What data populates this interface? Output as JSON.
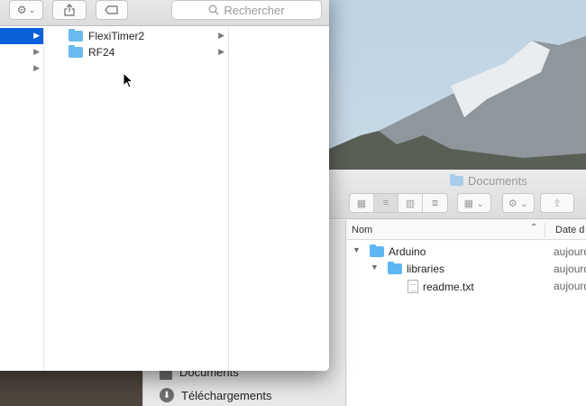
{
  "front_window": {
    "toolbar": {
      "action_icon": "gear-icon",
      "share_icon": "share-icon",
      "tag_icon": "tag-icon",
      "search_placeholder": "Rechercher"
    },
    "column2": {
      "items": [
        {
          "label": "FlexiTimer2"
        },
        {
          "label": "RF24"
        }
      ]
    }
  },
  "back_window": {
    "title": "Documents",
    "sidebar": {
      "items": [
        {
          "label": "Documents",
          "icon": "document-icon"
        },
        {
          "label": "Téléchargements",
          "icon": "download-icon"
        }
      ]
    },
    "list": {
      "columns": {
        "name": "Nom",
        "date": "Date d"
      },
      "rows": [
        {
          "name": "Arduino",
          "date": "aujourd",
          "type": "folder"
        },
        {
          "name": "libraries",
          "date": "aujourd",
          "type": "folder"
        },
        {
          "name": "readme.txt",
          "date": "aujourd",
          "type": "file"
        }
      ]
    }
  },
  "colors": {
    "selection": "#0a61d9",
    "folder": "#5eb6f2"
  }
}
